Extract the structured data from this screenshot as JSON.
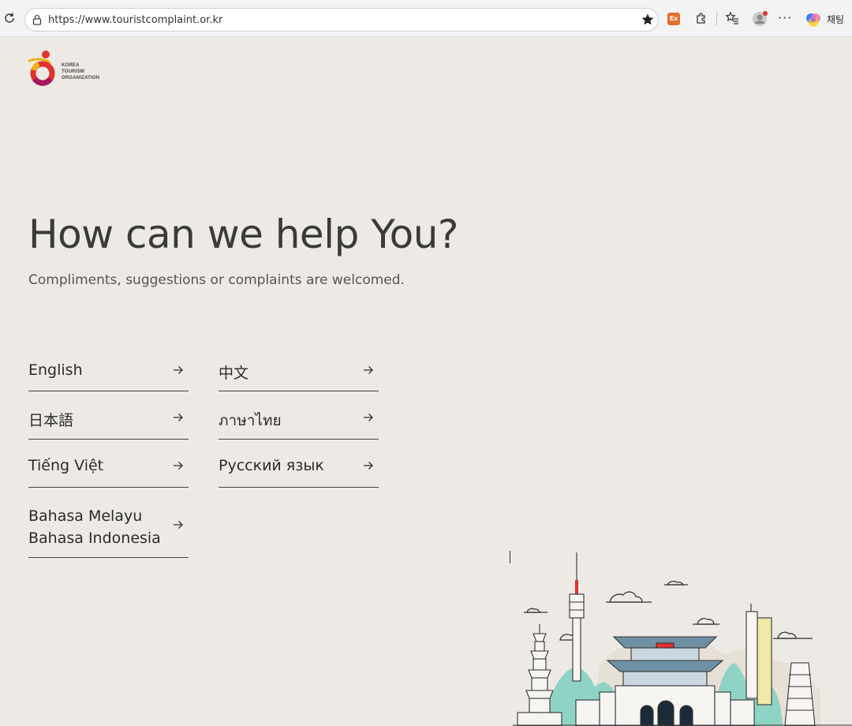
{
  "browser": {
    "url": "https://www.touristcomplaint.or.kr",
    "ext_badge": "Ex",
    "copilot_label": "채팅",
    "more": "···"
  },
  "logo": {
    "lines": [
      "KOREA",
      "TOURISM",
      "ORGANIZATION"
    ],
    "colors": [
      "#e0312e",
      "#f3b21b",
      "#a3195b"
    ]
  },
  "hero": {
    "title": "How can we help You?",
    "subtitle": "Compliments, suggestions or complaints are welcomed."
  },
  "languages": [
    {
      "label": "English"
    },
    {
      "label": "中文"
    },
    {
      "label": "日本語"
    },
    {
      "label": "ภาษาไทย"
    },
    {
      "label": "Tiếng Việt"
    },
    {
      "label": "Русский язык"
    },
    {
      "lines": [
        "Bahasa Melayu",
        "Bahasa Indonesia"
      ]
    }
  ],
  "colors": {
    "background": "#edeae5",
    "text": "#333333",
    "illustration_teal": "#8fd3c6"
  }
}
